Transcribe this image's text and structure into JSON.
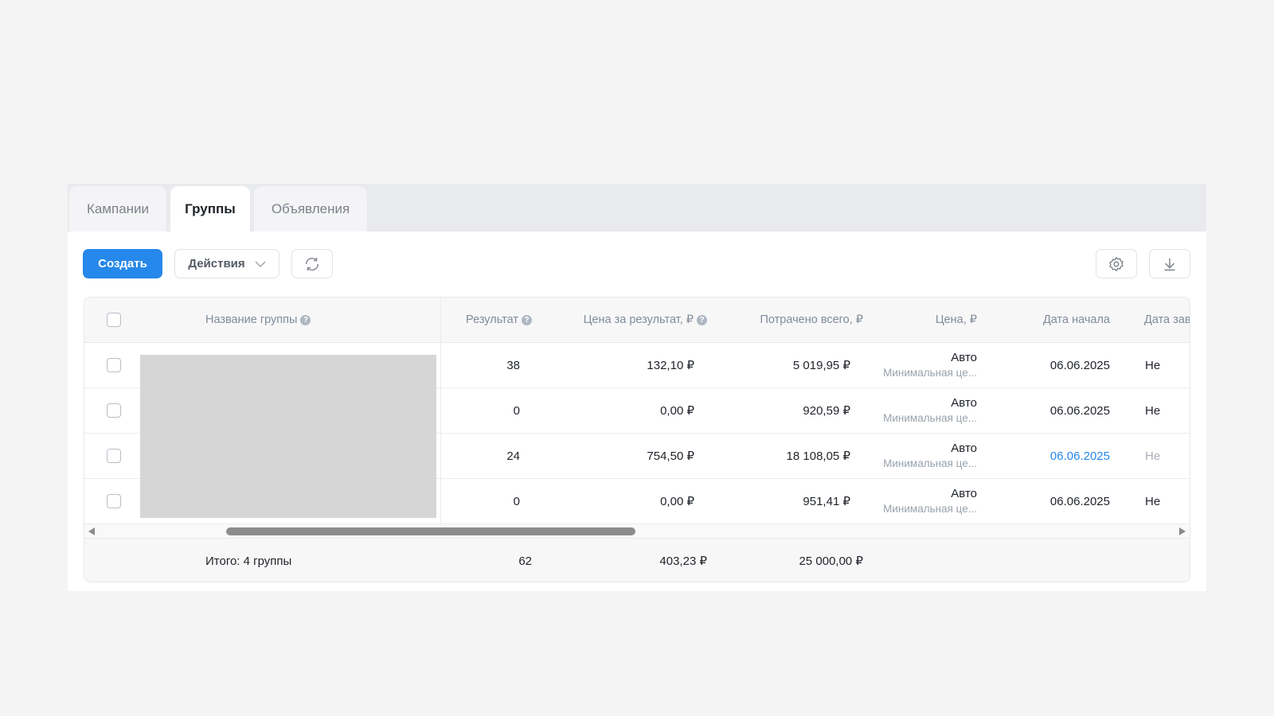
{
  "tabs": [
    {
      "label": "Кампании"
    },
    {
      "label": "Группы",
      "active": true
    },
    {
      "label": "Объявления"
    }
  ],
  "toolbar": {
    "create": "Создать",
    "actions": "Действия",
    "refresh_icon": "refresh-icon",
    "settings_icon": "gear-icon",
    "download_icon": "download-icon"
  },
  "colors": {
    "accent": "#2688eb",
    "link": "#2688eb"
  },
  "table": {
    "headers": {
      "name": "Название группы",
      "result": "Результат",
      "cpr": "Цена за результат, ₽",
      "spent": "Потрачено всего, ₽",
      "price": "Цена, ₽",
      "start": "Дата начала",
      "end": "Дата зав"
    },
    "rows": [
      {
        "result": "38",
        "cpr": "132,10 ₽",
        "spent": "5 019,95 ₽",
        "price": "Авто",
        "price_sub": "Минимальная це...",
        "start": "06.06.2025",
        "end": "Не"
      },
      {
        "result": "0",
        "cpr": "0,00 ₽",
        "spent": "920,59 ₽",
        "price": "Авто",
        "price_sub": "Минимальная це...",
        "start": "06.06.2025",
        "end": "Не"
      },
      {
        "result": "24",
        "cpr": "754,50 ₽",
        "spent": "18 108,05 ₽",
        "price": "Авто",
        "price_sub": "Минимальная це...",
        "start": "06.06.2025",
        "end": "Не"
      },
      {
        "result": "0",
        "cpr": "0,00 ₽",
        "spent": "951,41 ₽",
        "price": "Авто",
        "price_sub": "Минимальная це...",
        "start": "06.06.2025",
        "end": "Не"
      }
    ],
    "footer": {
      "label": "Итого: 4 группы",
      "result": "62",
      "cpr": "403,23 ₽",
      "spent": "25 000,00 ₽"
    }
  }
}
